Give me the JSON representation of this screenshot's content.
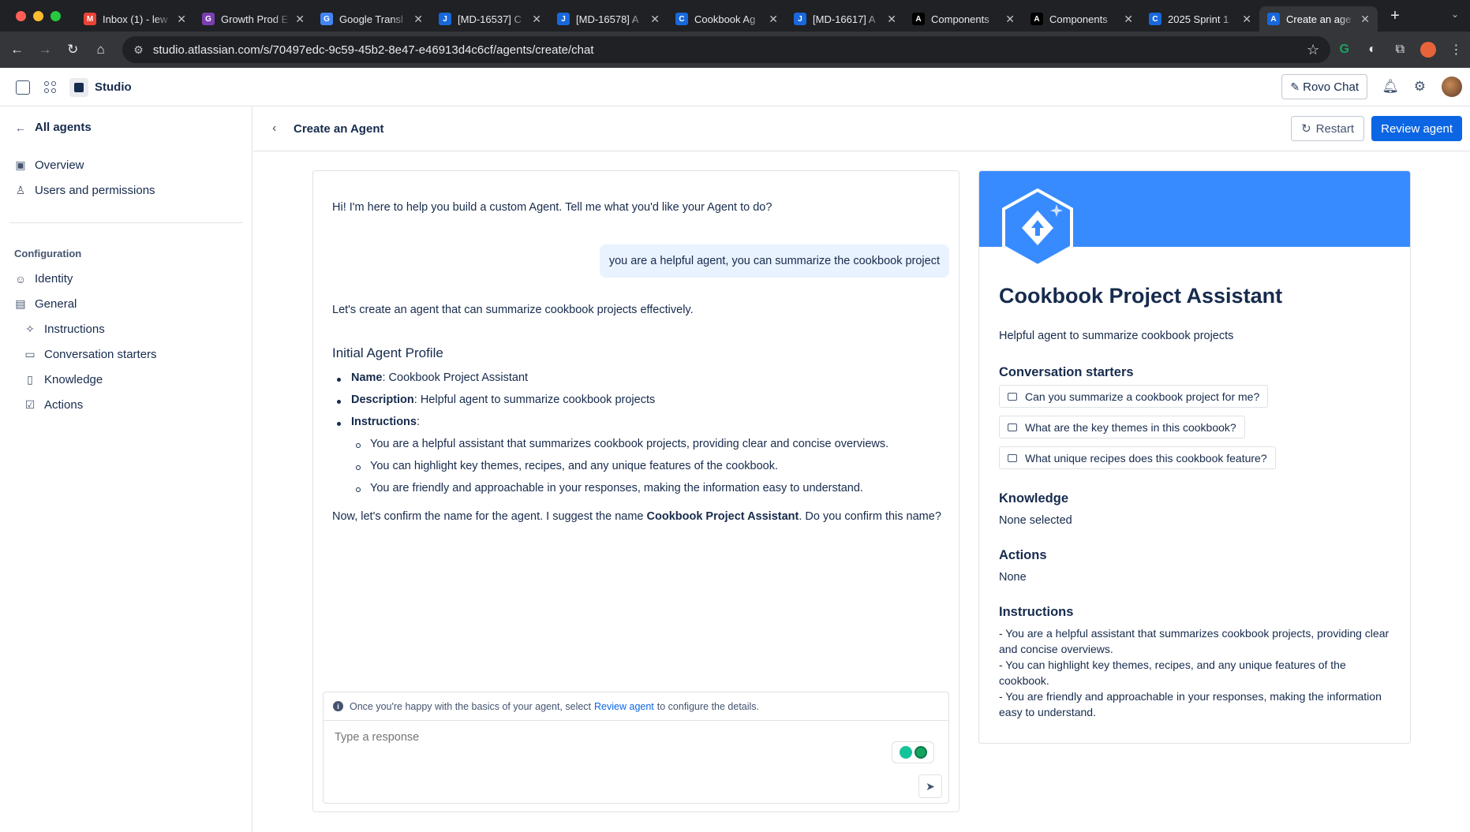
{
  "browser": {
    "tabs": [
      {
        "title": "Inbox (1) - lew",
        "favicon": "gmail-icon",
        "color": "#ea4335",
        "glyph": "M"
      },
      {
        "title": "Growth Prod E",
        "favicon": "growth-icon",
        "color": "#7b3fb0",
        "glyph": "G"
      },
      {
        "title": "Google Transl",
        "favicon": "google-translate-icon",
        "color": "#4285f4",
        "glyph": "G"
      },
      {
        "title": "[MD-16537] C",
        "favicon": "jira-icon",
        "color": "#1868db",
        "glyph": "J"
      },
      {
        "title": "[MD-16578] A",
        "favicon": "jira-icon",
        "color": "#1868db",
        "glyph": "J"
      },
      {
        "title": "Cookbook Ag",
        "favicon": "confluence-icon",
        "color": "#1868db",
        "glyph": "C"
      },
      {
        "title": "[MD-16617] A",
        "favicon": "jira-icon",
        "color": "#1868db",
        "glyph": "J"
      },
      {
        "title": "Components",
        "favicon": "atlassian-icon",
        "color": "#000000",
        "glyph": "A"
      },
      {
        "title": "Components",
        "favicon": "atlassian-icon",
        "color": "#000000",
        "glyph": "A"
      },
      {
        "title": "2025 Sprint 1",
        "favicon": "confluence-icon",
        "color": "#1868db",
        "glyph": "C"
      },
      {
        "title": "Create an age",
        "favicon": "atlassian-icon",
        "color": "#1868db",
        "glyph": "A",
        "active": true
      }
    ],
    "url": "studio.atlassian.com/s/70497edc-9c59-45b2-8e47-e46913d4c6cf/agents/create/chat"
  },
  "header": {
    "app_name": "Studio",
    "rovo_chat_label": "Rovo Chat"
  },
  "sidebar": {
    "back_label": "All agents",
    "items": [
      {
        "label": "Overview",
        "icon": "overview-icon"
      },
      {
        "label": "Users and permissions",
        "icon": "person-icon"
      }
    ],
    "section_heading": "Configuration",
    "config_items": [
      {
        "label": "Identity",
        "icon": "smiley-icon"
      },
      {
        "label": "General",
        "icon": "card-icon"
      }
    ],
    "general_subitems": [
      {
        "label": "Instructions",
        "icon": "instructions-icon"
      },
      {
        "label": "Conversation starters",
        "icon": "comment-icon"
      },
      {
        "label": "Knowledge",
        "icon": "book-icon"
      },
      {
        "label": "Actions",
        "icon": "checkbox-icon"
      }
    ]
  },
  "content_header": {
    "title": "Create an Agent",
    "restart_label": "Restart",
    "review_label": "Review agent"
  },
  "chat": {
    "greeting": "Hi! I'm here to help you build a custom Agent. Tell me what you'd like your Agent to do?",
    "user_message": "you are a helpful agent, you can summarize the cookbook project",
    "reply_intro": "Let's create an agent that can summarize cookbook projects effectively.",
    "profile_heading": "Initial Agent Profile",
    "name_key": "Name",
    "name_value": ": Cookbook Project Assistant",
    "description_key": "Description",
    "description_value": ": Helpful agent to summarize cookbook projects",
    "instructions_key": "Instructions",
    "instructions_colon": ":",
    "instructions": [
      "You are a helpful assistant that summarizes cookbook projects, providing clear and concise overviews.",
      "You can highlight key themes, recipes, and any unique features of the cookbook.",
      "You are friendly and approachable in your responses, making the information easy to understand."
    ],
    "confirm_prefix": "Now, let's confirm the name for the agent. I suggest the name ",
    "confirm_name": "Cookbook Project Assistant",
    "confirm_suffix": ". Do you confirm this name?",
    "hint_prefix": "Once you're happy with the basics of your agent, select",
    "hint_link": "Review agent",
    "hint_suffix": "to configure the details.",
    "input_placeholder": "Type a response"
  },
  "preview": {
    "banner_color": "#388bff",
    "name": "Cookbook Project Assistant",
    "description": "Helpful agent to summarize cookbook projects",
    "starters_heading": "Conversation starters",
    "starters": [
      "Can you summarize a cookbook project for me?",
      "What are the key themes in this cookbook?",
      "What unique recipes does this cookbook feature?"
    ],
    "knowledge_heading": "Knowledge",
    "knowledge_value": "None selected",
    "actions_heading": "Actions",
    "actions_value": "None",
    "instructions_heading": "Instructions",
    "instructions_text": [
      "- You are a helpful assistant that summarizes cookbook projects, providing clear and concise overviews.",
      "- You can highlight key themes, recipes, and any unique features of the cookbook.",
      "- You are friendly and approachable in your responses, making the information easy to understand."
    ]
  }
}
